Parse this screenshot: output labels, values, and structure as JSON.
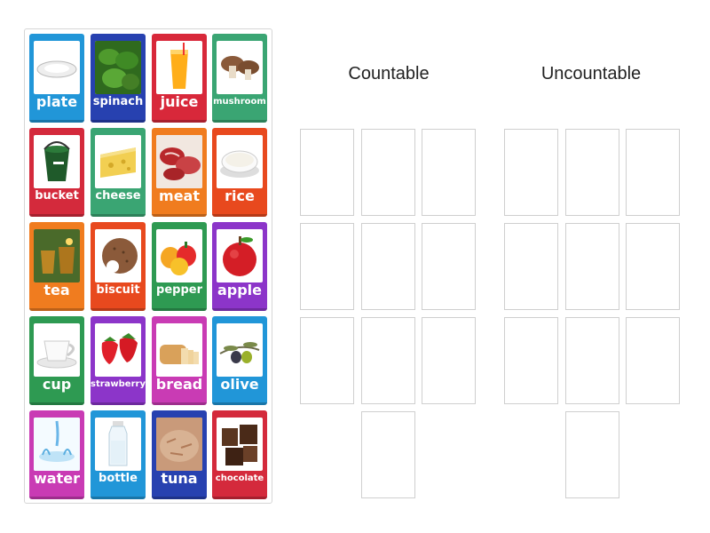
{
  "columns": {
    "countable": "Countable",
    "uncountable": "Uncountable"
  },
  "cards": [
    {
      "label": "plate",
      "color": "#2196d8",
      "icon": "plate-icon"
    },
    {
      "label": "spinach",
      "color": "#2741b0",
      "icon": "spinach-icon"
    },
    {
      "label": "juice",
      "color": "#d8283a",
      "icon": "juice-icon"
    },
    {
      "label": "mushroom",
      "color": "#3aa573",
      "icon": "mushroom-icon"
    },
    {
      "label": "bucket",
      "color": "#d42a3c",
      "icon": "bucket-icon"
    },
    {
      "label": "cheese",
      "color": "#3aa573",
      "icon": "cheese-icon"
    },
    {
      "label": "meat",
      "color": "#f07c1f",
      "icon": "meat-icon"
    },
    {
      "label": "rice",
      "color": "#e8491e",
      "icon": "rice-icon"
    },
    {
      "label": "tea",
      "color": "#f07c1f",
      "icon": "tea-icon"
    },
    {
      "label": "biscuit",
      "color": "#e8491e",
      "icon": "biscuit-icon"
    },
    {
      "label": "pepper",
      "color": "#2e9a52",
      "icon": "pepper-icon"
    },
    {
      "label": "apple",
      "color": "#8c35c9",
      "icon": "apple-icon"
    },
    {
      "label": "cup",
      "color": "#2e9a52",
      "icon": "cup-icon"
    },
    {
      "label": "strawberry",
      "color": "#8c35c9",
      "icon": "strawberry-icon"
    },
    {
      "label": "bread",
      "color": "#c93bb4",
      "icon": "bread-icon"
    },
    {
      "label": "olive",
      "color": "#2196d8",
      "icon": "olive-icon"
    },
    {
      "label": "water",
      "color": "#c93bb4",
      "icon": "water-icon"
    },
    {
      "label": "bottle",
      "color": "#2196d8",
      "icon": "bottle-icon"
    },
    {
      "label": "tuna",
      "color": "#2741b0",
      "icon": "tuna-icon"
    },
    {
      "label": "chocolate",
      "color": "#d42a3c",
      "icon": "chocolate-icon"
    }
  ]
}
